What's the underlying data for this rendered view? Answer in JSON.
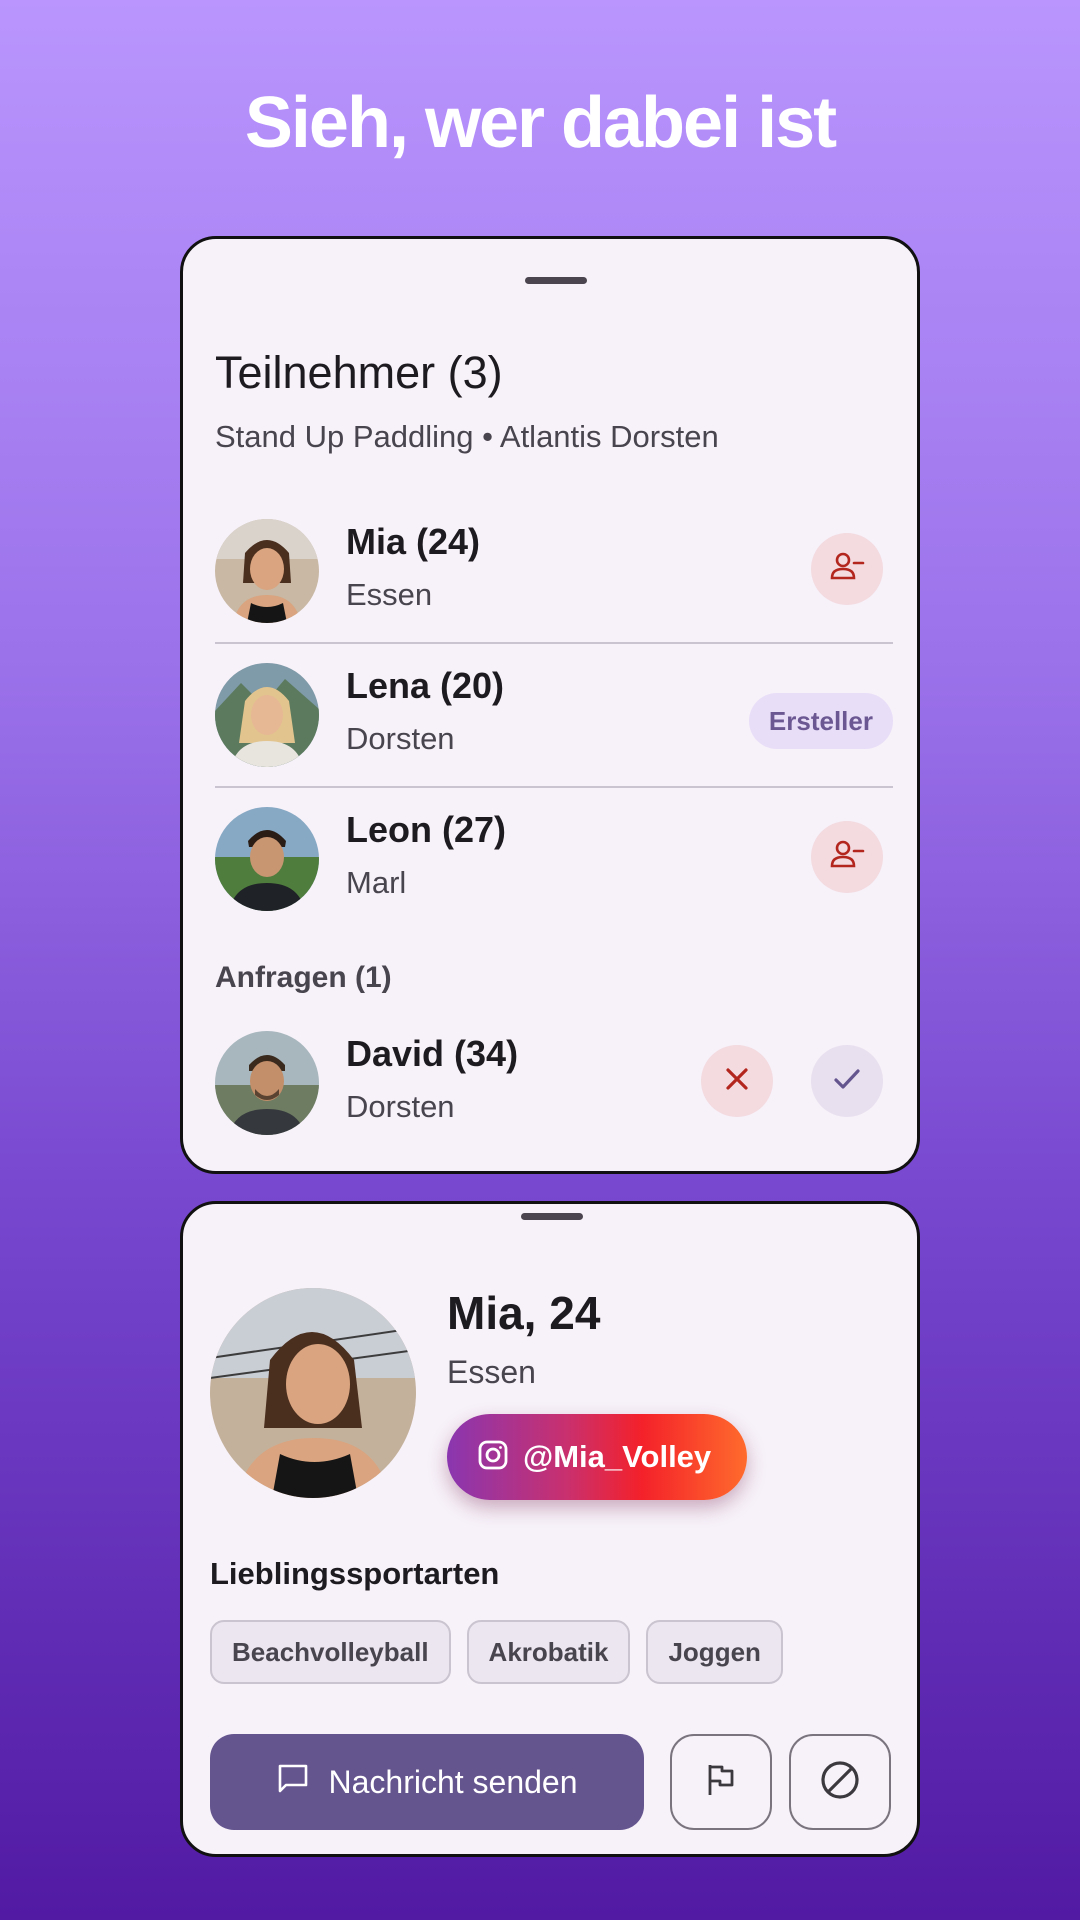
{
  "headline": "Sieh, wer dabei ist",
  "participants_sheet": {
    "title": "Teilnehmer (3)",
    "subtitle": "Stand Up Paddling • Atlantis Dorsten",
    "participants": [
      {
        "name": "Mia (24)",
        "city": "Essen",
        "action": "remove-person-icon"
      },
      {
        "name": "Lena (20)",
        "city": "Dorsten",
        "badge": "Ersteller"
      },
      {
        "name": "Leon (27)",
        "city": "Marl",
        "action": "remove-person-icon"
      }
    ],
    "requests_label": "Anfragen (1)",
    "requests": [
      {
        "name": "David (34)",
        "city": "Dorsten",
        "actions": [
          "reject-icon",
          "accept-icon"
        ]
      }
    ]
  },
  "profile_sheet": {
    "name": "Mia, 24",
    "city": "Essen",
    "instagram_handle": "@Mia_Volley",
    "favorites_title": "Lieblingssportarten",
    "sports": [
      "Beachvolleyball",
      "Akrobatik",
      "Joggen"
    ],
    "message_button": "Nachricht senden",
    "report_icon": "flag-icon",
    "block_icon": "block-icon"
  },
  "colors": {
    "accent": "#65558f",
    "danger": "#b3261e",
    "danger_bg": "#f3dbe0",
    "badge_bg": "#e8def8",
    "sheet_bg": "#f7f1f9"
  }
}
